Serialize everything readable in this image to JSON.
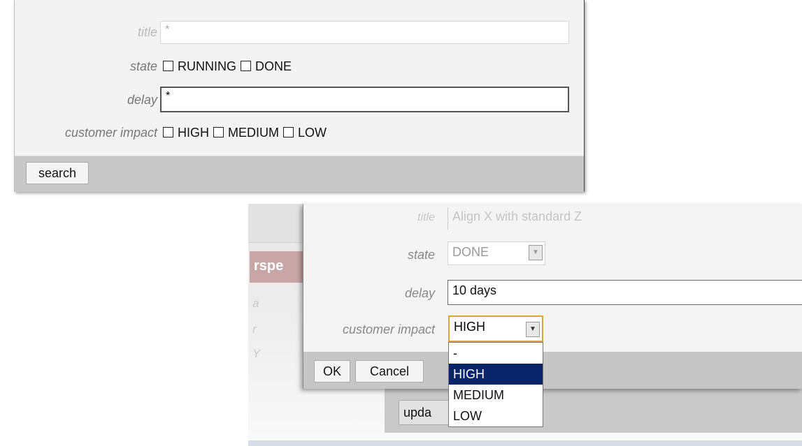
{
  "search": {
    "title_label": "title",
    "title_value": "*",
    "state_label": "state",
    "state_options": [
      "RUNNING",
      "DONE"
    ],
    "delay_label": "delay",
    "delay_value": "*",
    "impact_label": "customer impact",
    "impact_options": [
      "HIGH",
      "MEDIUM",
      "LOW"
    ],
    "search_button": "search"
  },
  "background": {
    "header_fragment": "rspe",
    "text_a": "a",
    "text_b": "r",
    "text_c": "Y",
    "update_button_fragment": "upda"
  },
  "dialog": {
    "title_label": "title",
    "title_value": "Align X with standard Z",
    "state_label": "state",
    "state_value": "DONE",
    "delay_label": "delay",
    "delay_value": "10 days",
    "impact_label": "customer impact",
    "impact_value": "HIGH",
    "ok_button": "OK",
    "cancel_button": "Cancel",
    "impact_dropdown": [
      "-",
      "HIGH",
      "MEDIUM",
      "LOW"
    ],
    "impact_selected_index": 1
  },
  "colors": {
    "selection": "#0a246a",
    "footer": "#c8c8c8"
  }
}
